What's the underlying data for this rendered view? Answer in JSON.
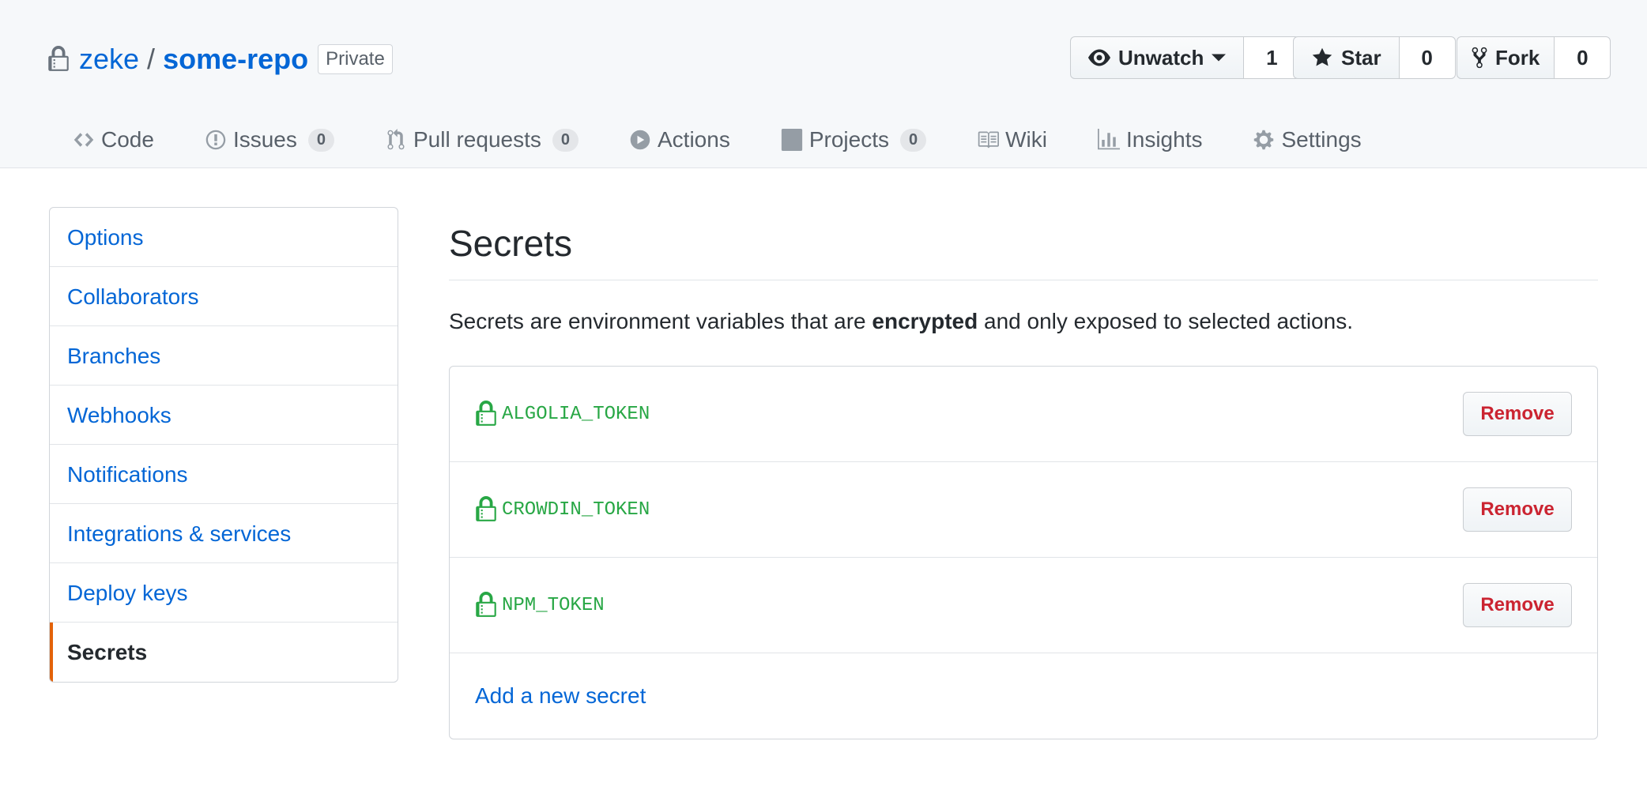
{
  "repo": {
    "owner": "zeke",
    "separator": "/",
    "name": "some-repo",
    "visibility": "Private"
  },
  "actions": {
    "watch": {
      "label": "Unwatch",
      "count": "1"
    },
    "star": {
      "label": "Star",
      "count": "0"
    },
    "fork": {
      "label": "Fork",
      "count": "0"
    }
  },
  "tabs": [
    {
      "label": "Code",
      "icon": "code-icon"
    },
    {
      "label": "Issues",
      "icon": "issue-icon",
      "count": "0"
    },
    {
      "label": "Pull requests",
      "icon": "pull-request-icon",
      "count": "0"
    },
    {
      "label": "Actions",
      "icon": "play-icon"
    },
    {
      "label": "Projects",
      "icon": "project-icon",
      "count": "0"
    },
    {
      "label": "Wiki",
      "icon": "book-icon"
    },
    {
      "label": "Insights",
      "icon": "graph-icon"
    },
    {
      "label": "Settings",
      "icon": "gear-icon"
    }
  ],
  "sidebar": {
    "items": [
      {
        "label": "Options"
      },
      {
        "label": "Collaborators"
      },
      {
        "label": "Branches"
      },
      {
        "label": "Webhooks"
      },
      {
        "label": "Notifications"
      },
      {
        "label": "Integrations & services"
      },
      {
        "label": "Deploy keys"
      },
      {
        "label": "Secrets",
        "selected": true
      }
    ]
  },
  "main": {
    "title": "Secrets",
    "description": {
      "before": "Secrets are environment variables that are ",
      "bold": "encrypted",
      "after": " and only exposed to selected actions."
    },
    "secrets": [
      {
        "name": "ALGOLIA_TOKEN",
        "action": "Remove"
      },
      {
        "name": "CROWDIN_TOKEN",
        "action": "Remove"
      },
      {
        "name": "NPM_TOKEN",
        "action": "Remove"
      }
    ],
    "add_link": "Add a new secret"
  },
  "colors": {
    "link": "#0366d6",
    "secret": "#28a745",
    "danger": "#cb2431",
    "selected_accent": "#e36209"
  }
}
